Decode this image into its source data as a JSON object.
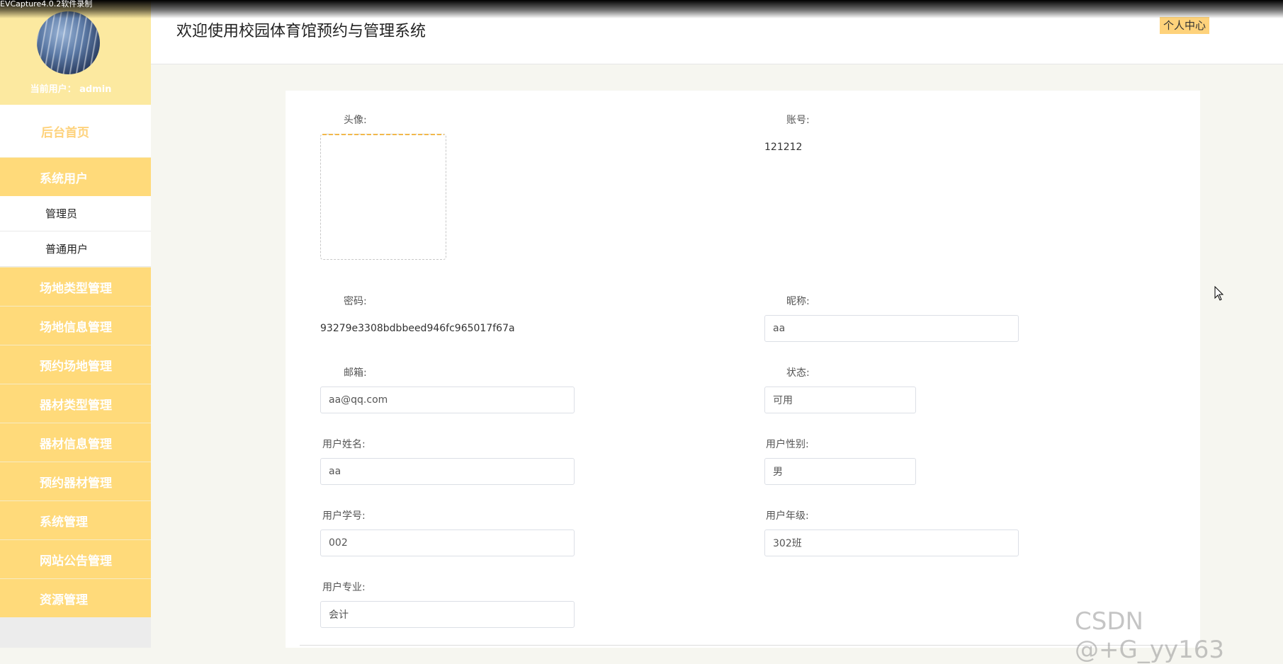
{
  "recorder": {
    "title": "EVCapture4.0.2软件录制"
  },
  "sidebar": {
    "current_user": "当前用户： admin",
    "home_label": "后台首页",
    "groups": [
      {
        "label": "系统用户",
        "items": [
          "管理员",
          "普通用户"
        ]
      },
      {
        "label": "场地类型管理"
      },
      {
        "label": "场地信息管理"
      },
      {
        "label": "预约场地管理"
      },
      {
        "label": "器材类型管理"
      },
      {
        "label": "器材信息管理"
      },
      {
        "label": "预约器材管理"
      },
      {
        "label": "系统管理"
      },
      {
        "label": "网站公告管理"
      },
      {
        "label": "资源管理"
      }
    ]
  },
  "header": {
    "title": "欢迎使用校园体育馆预约与管理系统",
    "personal_center": "个人中心"
  },
  "form": {
    "avatar_label": "头像:",
    "account_label": "账号:",
    "account_value": "121212",
    "password_label": "密码:",
    "password_value": "93279e3308bdbbeed946fc965017f67a",
    "nickname_label": "昵称:",
    "nickname_value": "aa",
    "email_label": "邮箱:",
    "email_value": "aa@qq.com",
    "status_label": "状态:",
    "status_value": "可用",
    "name_label": "用户姓名:",
    "name_value": "aa",
    "gender_label": "用户性别:",
    "gender_value": "男",
    "student_no_label": "用户学号:",
    "student_no_value": "002",
    "grade_label": "用户年级:",
    "grade_value": "302班",
    "major_label": "用户专业:",
    "major_value": "会计"
  },
  "watermark": "CSDN @+G_yy163",
  "colors": {
    "accent": "#ffda7a",
    "accent_light": "#fce9a0",
    "home_text": "#fed27b"
  }
}
